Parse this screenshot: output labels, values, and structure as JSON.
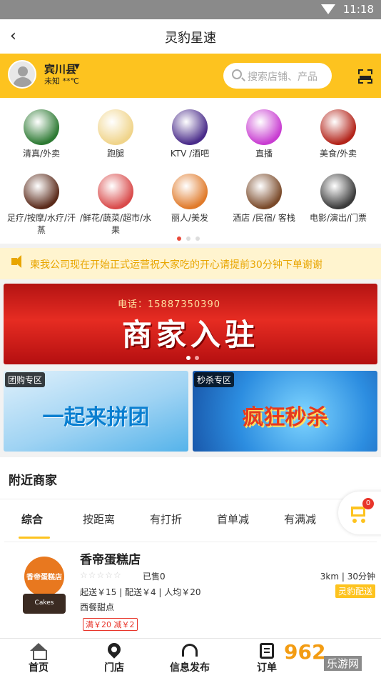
{
  "status": {
    "time": "11:18"
  },
  "header": {
    "title": "灵豹星速"
  },
  "topbar": {
    "location": "宾川县",
    "weather": "未知 **℃",
    "search_placeholder": "搜索店铺、产品"
  },
  "categories": [
    {
      "label": "清真/外卖",
      "icon": "halal-icon",
      "color": "#2d7a33"
    },
    {
      "label": "跑腿",
      "icon": "errand-icon",
      "color": "#f0d48a"
    },
    {
      "label": "KTV /酒吧",
      "icon": "ktv-icon",
      "color": "#4a2c8a"
    },
    {
      "label": "直播",
      "icon": "live-icon",
      "color": "#c83cd1"
    },
    {
      "label": "美食/外卖",
      "icon": "food-icon",
      "color": "#b3241a"
    },
    {
      "label": "足疗/按摩/水疗/汗蒸",
      "icon": "massage-icon",
      "color": "#5a2a1a"
    },
    {
      "label": "/鲜花/蔬菜/超市/水果",
      "icon": "flower-icon",
      "color": "#d94a4a"
    },
    {
      "label": "丽人/美发",
      "icon": "beauty-icon",
      "color": "#e07a2a"
    },
    {
      "label": "酒店 /民宿/ 客栈",
      "icon": "hotel-icon",
      "color": "#7a4a2a"
    },
    {
      "label": "电影/演出/门票",
      "icon": "movie-icon",
      "color": "#3a3a3a"
    }
  ],
  "notice": {
    "text": "柬我公司现在开始正式运营祝大家吃的开心请提前30分钟下单谢谢"
  },
  "banner": {
    "phone": "电话：15887350390",
    "headline": "商家入驻"
  },
  "promos": [
    {
      "tag": "团购专区",
      "title": "一起来拼团"
    },
    {
      "tag": "秒杀专区",
      "title": "疯狂秒杀"
    }
  ],
  "nearby": {
    "heading": "附近商家",
    "tabs": [
      "综合",
      "按距离",
      "有打折",
      "首单减",
      "有满减"
    ],
    "cart_count": "0",
    "store": {
      "name": "香帝蛋糕店",
      "logo_text": "香帝蛋糕店",
      "logo_sub": "Cakes",
      "stars": "☆☆☆☆☆",
      "sold": "已售0",
      "distance": "3km | 30分钟",
      "fees": "起送￥15 | 配送￥4 | 人均￥20",
      "badge": "灵豹配送",
      "type": "西餐甜点",
      "offer": "满￥20 减￥2"
    }
  },
  "bottom_nav": [
    "首页",
    "门店",
    "信息发布",
    "订单"
  ],
  "watermark": {
    "brand": "962",
    "sub": "乐游网"
  }
}
